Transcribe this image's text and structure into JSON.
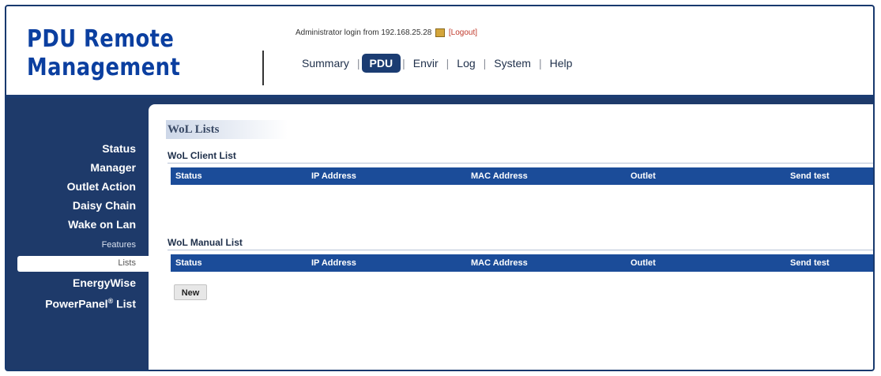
{
  "brand": {
    "line1": "PDU Remote",
    "line2": "Management"
  },
  "login": {
    "text": "Administrator login from 192.168.25.28",
    "logout": "[Logout]"
  },
  "nav": [
    "Summary",
    "PDU",
    "Envir",
    "Log",
    "System",
    "Help"
  ],
  "nav_active": "PDU",
  "sidebar": {
    "items": [
      "Status",
      "Manager",
      "Outlet Action",
      "Daisy Chain",
      "Wake on Lan"
    ],
    "sub_features": "Features",
    "sub_lists": "Lists",
    "energywise": "EnergyWise",
    "powerpanel": "PowerPanel",
    "powerpanel_reg": "®",
    "powerpanel_suffix": " List"
  },
  "main": {
    "title": "WoL Lists",
    "client_title": "WoL Client List",
    "manual_title": "WoL Manual List",
    "columns": [
      "Status",
      "IP Address",
      "MAC Address",
      "Outlet",
      "Send test"
    ],
    "new_button": "New"
  },
  "colors": {
    "brand": "#0b3fa0",
    "navy": "#1b3c72",
    "table_header": "#1b4c99",
    "logout": "#c0392b"
  }
}
